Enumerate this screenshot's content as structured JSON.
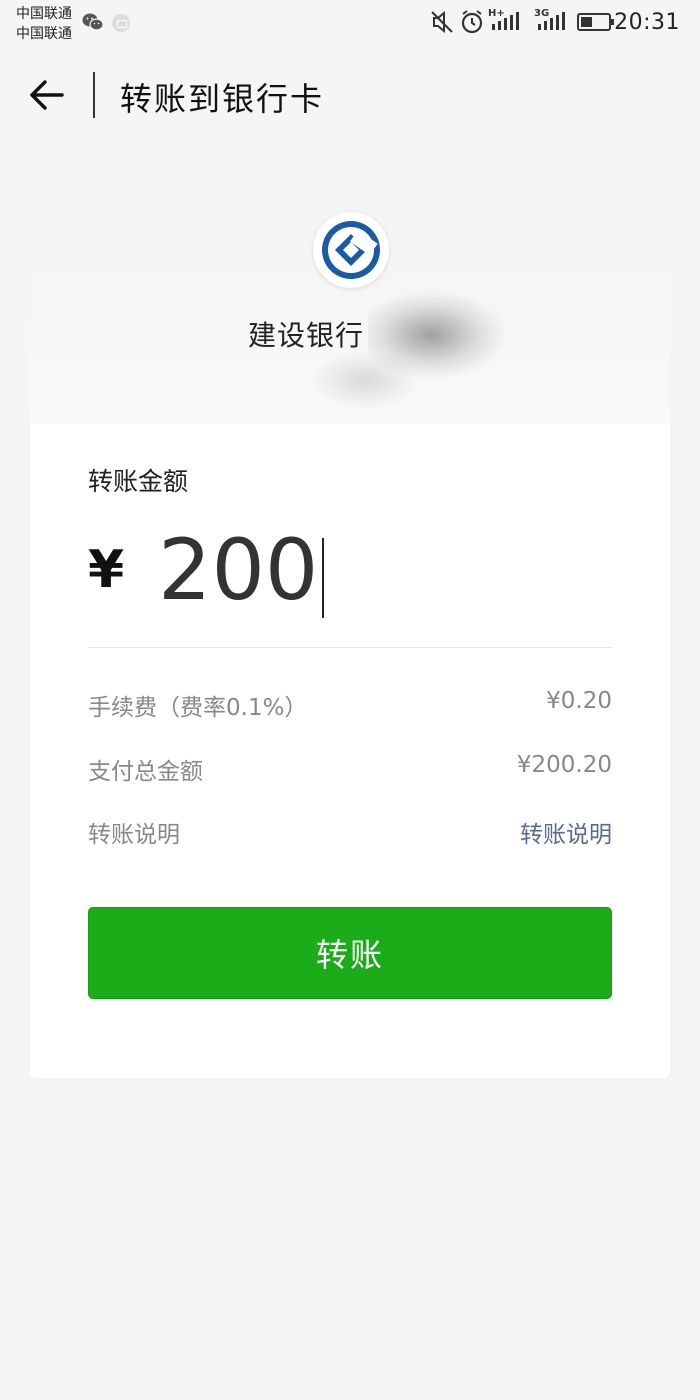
{
  "status_bar": {
    "carrier_1": "中国联通",
    "carrier_2": "中国联通",
    "network_1": "H+",
    "network_2": "3G",
    "time": "20:31",
    "icons": [
      "wechat-icon",
      "mail-icon",
      "mute-icon",
      "alarm-icon",
      "signal-icon",
      "battery-icon"
    ]
  },
  "header": {
    "title": "转账到银行卡",
    "back_icon": "arrow-left-icon"
  },
  "bank": {
    "name": "建设银行",
    "logo_icon": "ccb-logo-icon",
    "logo_color": "#1a5ba6"
  },
  "amount": {
    "label": "转账金额",
    "currency": "¥",
    "value": "200"
  },
  "details": {
    "fee_label": "手续费（费率0.1%）",
    "fee_value": "¥0.20",
    "total_label": "支付总金额",
    "total_value": "¥200.20",
    "note_label": "转账说明",
    "note_link": "转账说明"
  },
  "actions": {
    "transfer_label": "转账",
    "button_color": "#1aad19"
  },
  "colors": {
    "background": "#f5f5f7",
    "link": "#576b95",
    "muted_text": "#888888"
  }
}
